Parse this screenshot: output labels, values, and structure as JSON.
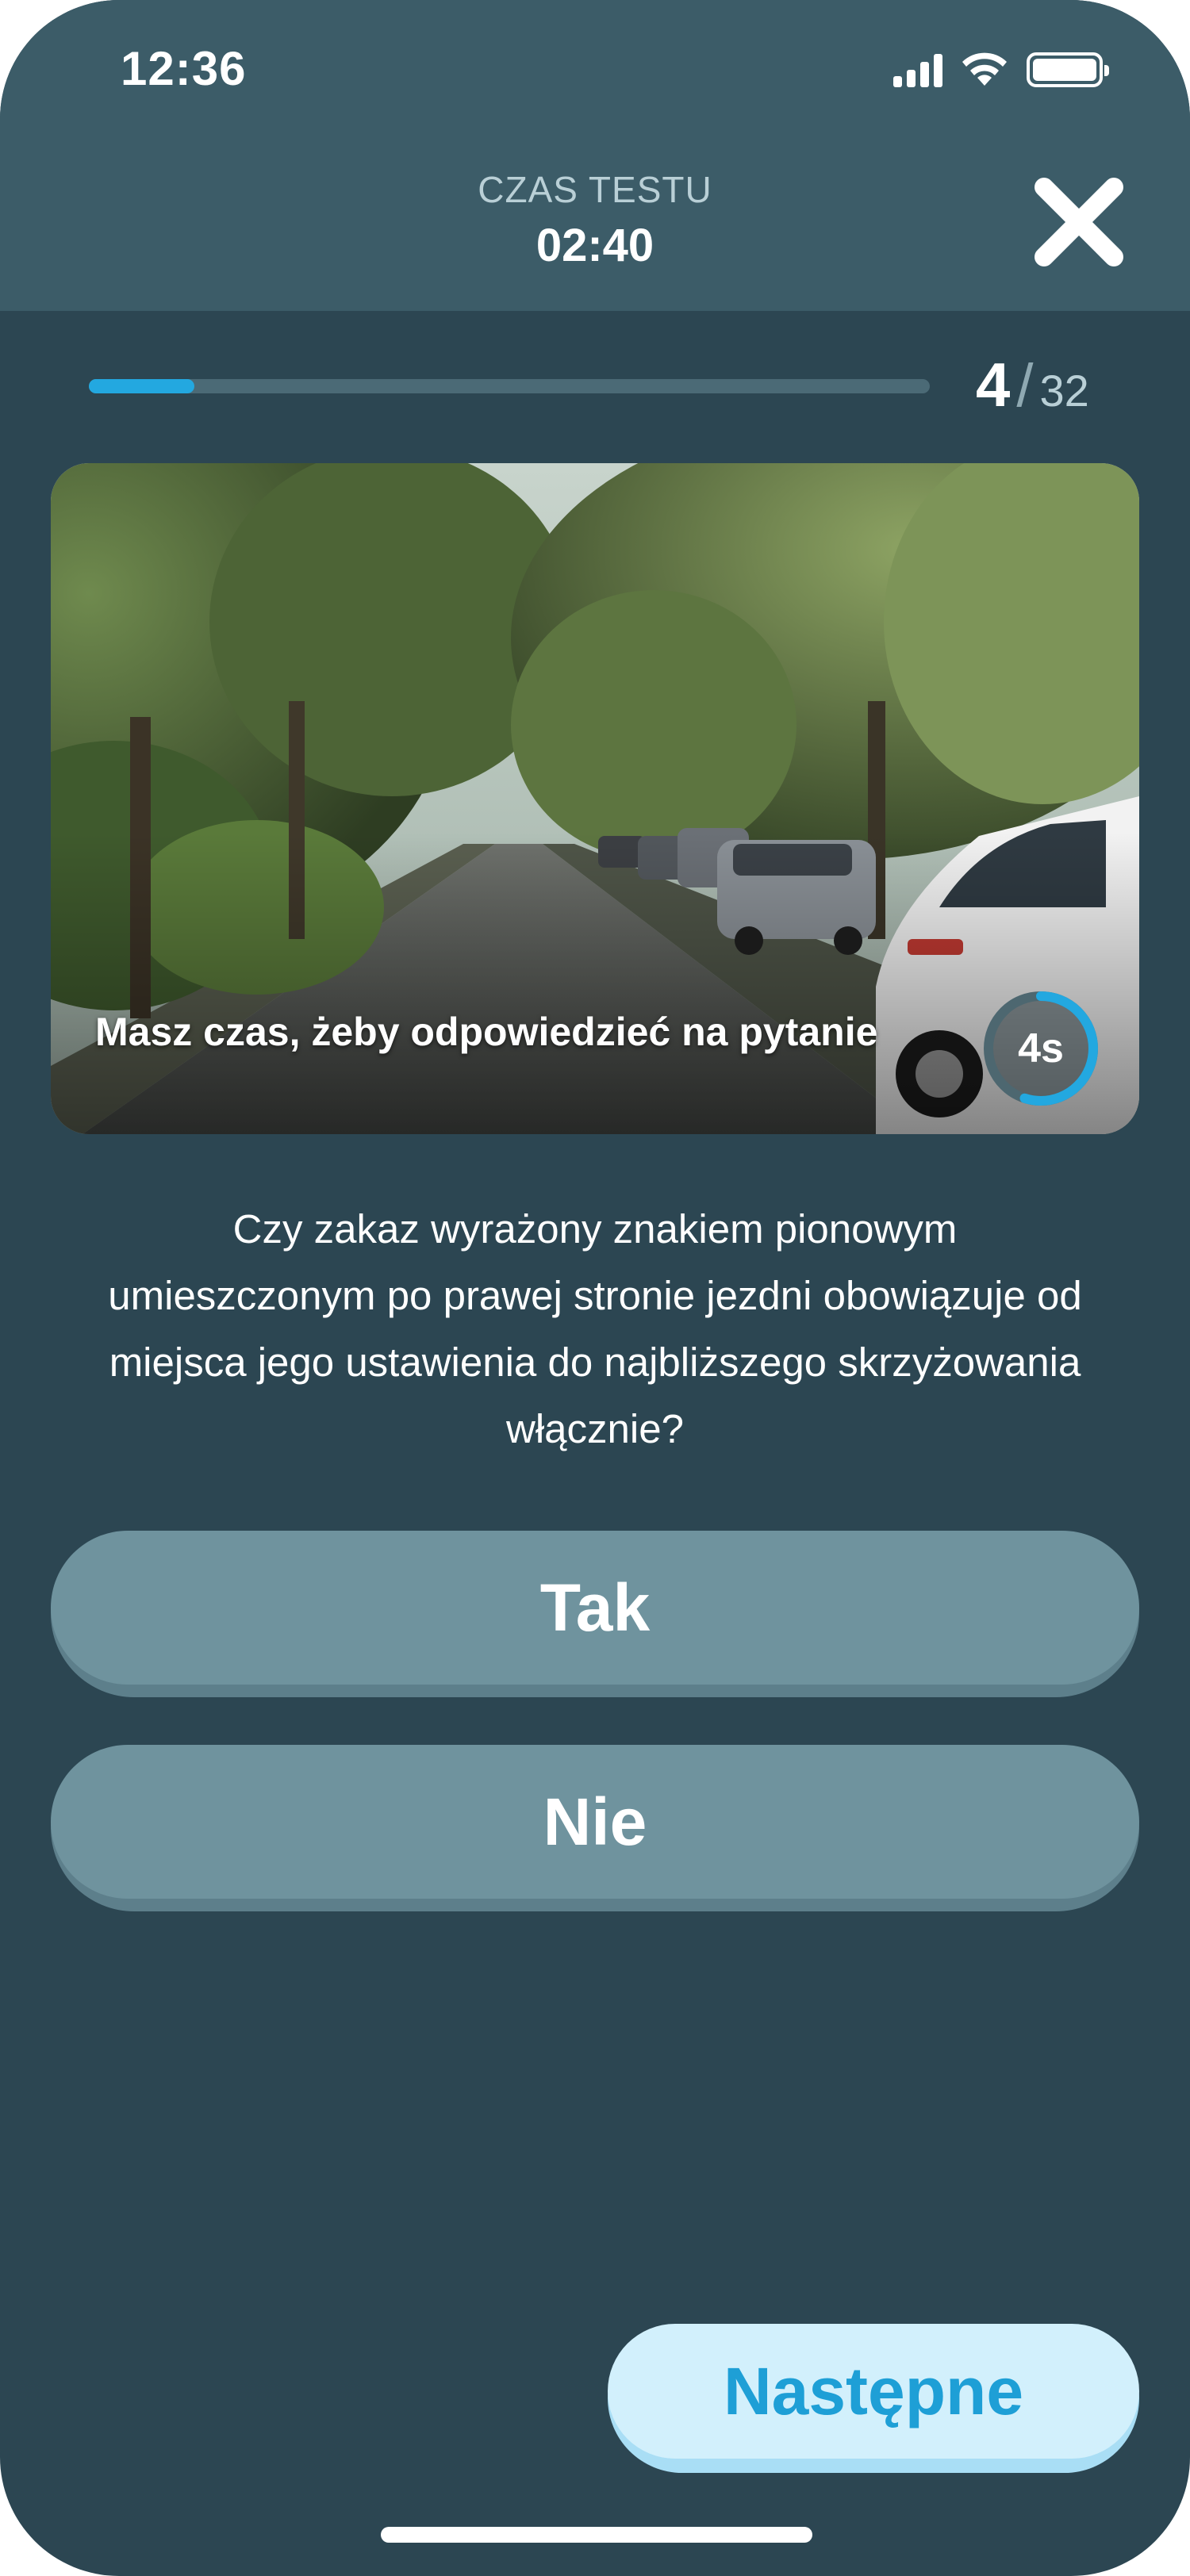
{
  "status_bar": {
    "time": "12:36"
  },
  "header": {
    "timer_label": "CZAS TESTU",
    "timer_value": "02:40"
  },
  "progress": {
    "current": "4",
    "separator": "/",
    "total": "32",
    "fraction": 0.125
  },
  "media": {
    "caption": "Masz czas, żeby odpowiedzieć na pytanie",
    "countdown": "4s",
    "countdown_fraction": 0.55
  },
  "question": {
    "text": "Czy zakaz wyrażony znakiem pionowym umieszczonym po prawej stronie jezdni obowiązuje od miejsca jego ustawienia do najbliższego skrzyżowania włącznie?"
  },
  "answers": [
    {
      "label": "Tak"
    },
    {
      "label": "Nie"
    }
  ],
  "next_button": {
    "label": "Następne"
  },
  "icons": {
    "close": "close-icon",
    "signal": "cellular-signal-icon",
    "wifi": "wifi-icon",
    "battery": "battery-icon"
  },
  "colors": {
    "background": "#2c4652",
    "header": "#3c5c68",
    "accent": "#23a8e0",
    "answer": "#6f939e",
    "next_button": "#d2f0fc"
  }
}
